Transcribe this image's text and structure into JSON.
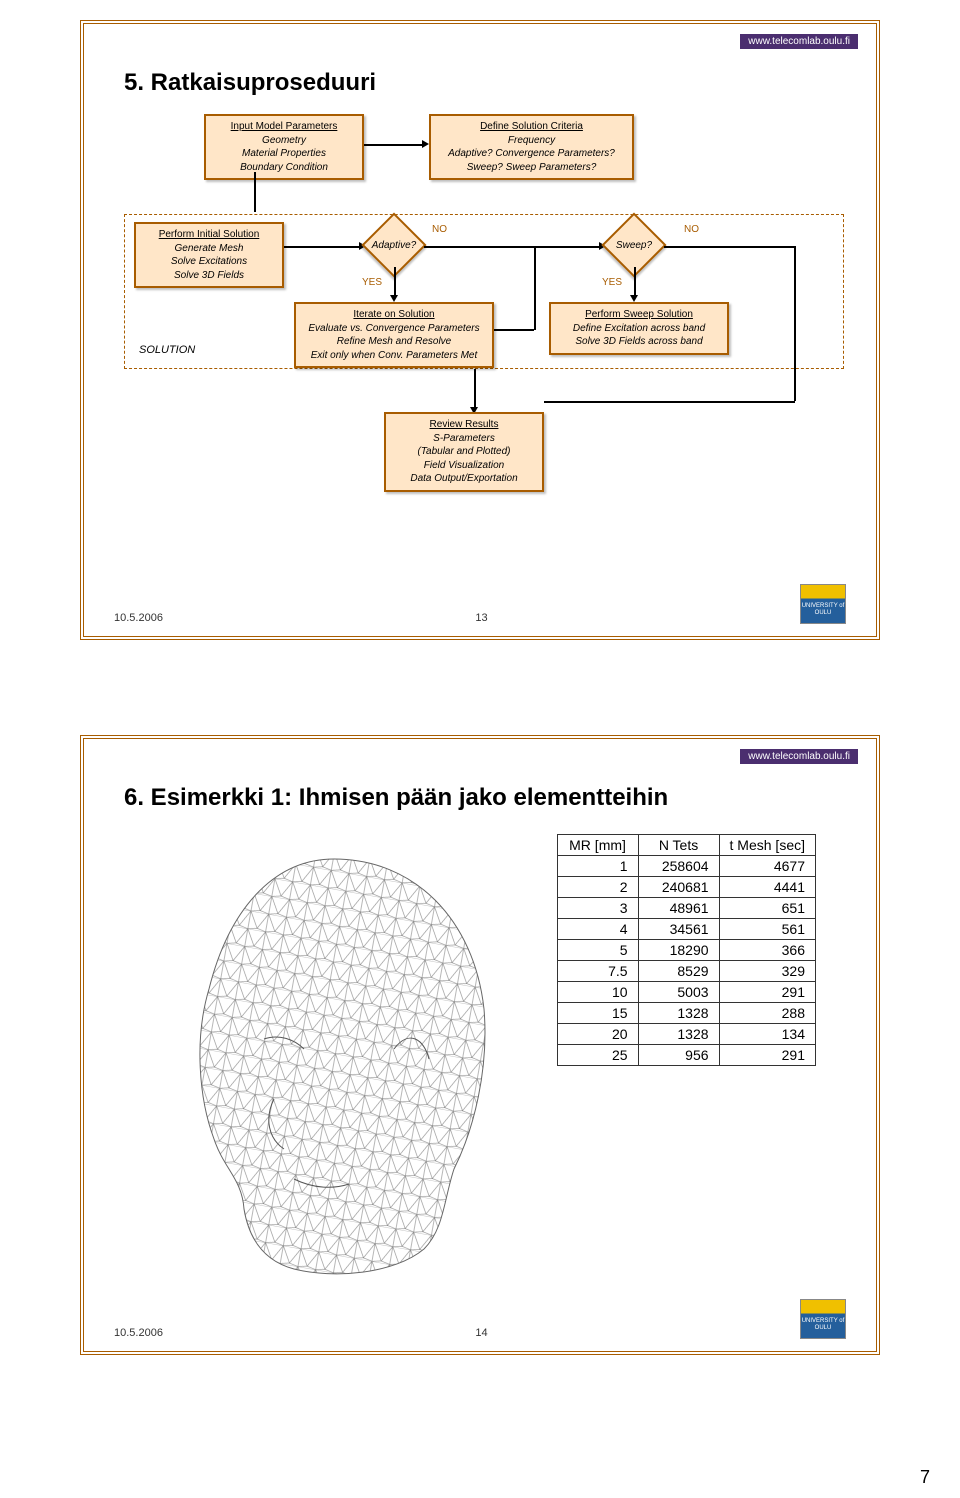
{
  "badge": "www.telecomlab.oulu.fi",
  "slide1": {
    "title": "5. Ratkaisuproseduuri",
    "box_input": {
      "hdr": "Input Model Parameters",
      "l1": "Geometry",
      "l2": "Material Properties",
      "l3": "Boundary Condition"
    },
    "box_define": {
      "hdr": "Define Solution Criteria",
      "l1": "Frequency",
      "l2": "Adaptive? Convergence Parameters?",
      "l3": "Sweep?  Sweep Parameters?"
    },
    "box_initial": {
      "hdr": "Perform Initial Solution",
      "l1": "Generate Mesh",
      "l2": "Solve Excitations",
      "l3": "Solve 3D Fields"
    },
    "diamond_adaptive": "Adaptive?",
    "diamond_sweep": "Sweep?",
    "labels": {
      "yes": "YES",
      "no": "NO"
    },
    "box_iterate": {
      "hdr": "Iterate on Solution",
      "l1": "Evaluate vs. Convergence Parameters",
      "l2": "Refine Mesh and Resolve",
      "l3": "Exit only when Conv. Parameters Met"
    },
    "box_sweep": {
      "hdr": "Perform Sweep Solution",
      "l1": "Define Excitation across band",
      "l2": "Solve 3D Fields across band"
    },
    "box_review": {
      "hdr": "Review Results",
      "l1": "S-Parameters",
      "l2": "(Tabular and Plotted)",
      "l3": "Field Visualization",
      "l4": "Data Output/Exportation"
    },
    "solution_label": "SOLUTION",
    "footer_date": "10.5.2006",
    "footer_num": "13",
    "uni": "UNIVERSITY of OULU"
  },
  "slide2": {
    "title": "6. Esimerkki 1: Ihmisen pään jako elementteihin",
    "table": {
      "headers": [
        "MR [mm]",
        "N Tets",
        "t Mesh [sec]"
      ],
      "rows": [
        [
          "1",
          "258604",
          "4677"
        ],
        [
          "2",
          "240681",
          "4441"
        ],
        [
          "3",
          "48961",
          "651"
        ],
        [
          "4",
          "34561",
          "561"
        ],
        [
          "5",
          "18290",
          "366"
        ],
        [
          "7.5",
          "8529",
          "329"
        ],
        [
          "10",
          "5003",
          "291"
        ],
        [
          "15",
          "1328",
          "288"
        ],
        [
          "20",
          "1328",
          "134"
        ],
        [
          "25",
          "956",
          "291"
        ]
      ]
    },
    "footer_date": "10.5.2006",
    "footer_num": "14",
    "uni": "UNIVERSITY of OULU"
  },
  "page_number": "7"
}
